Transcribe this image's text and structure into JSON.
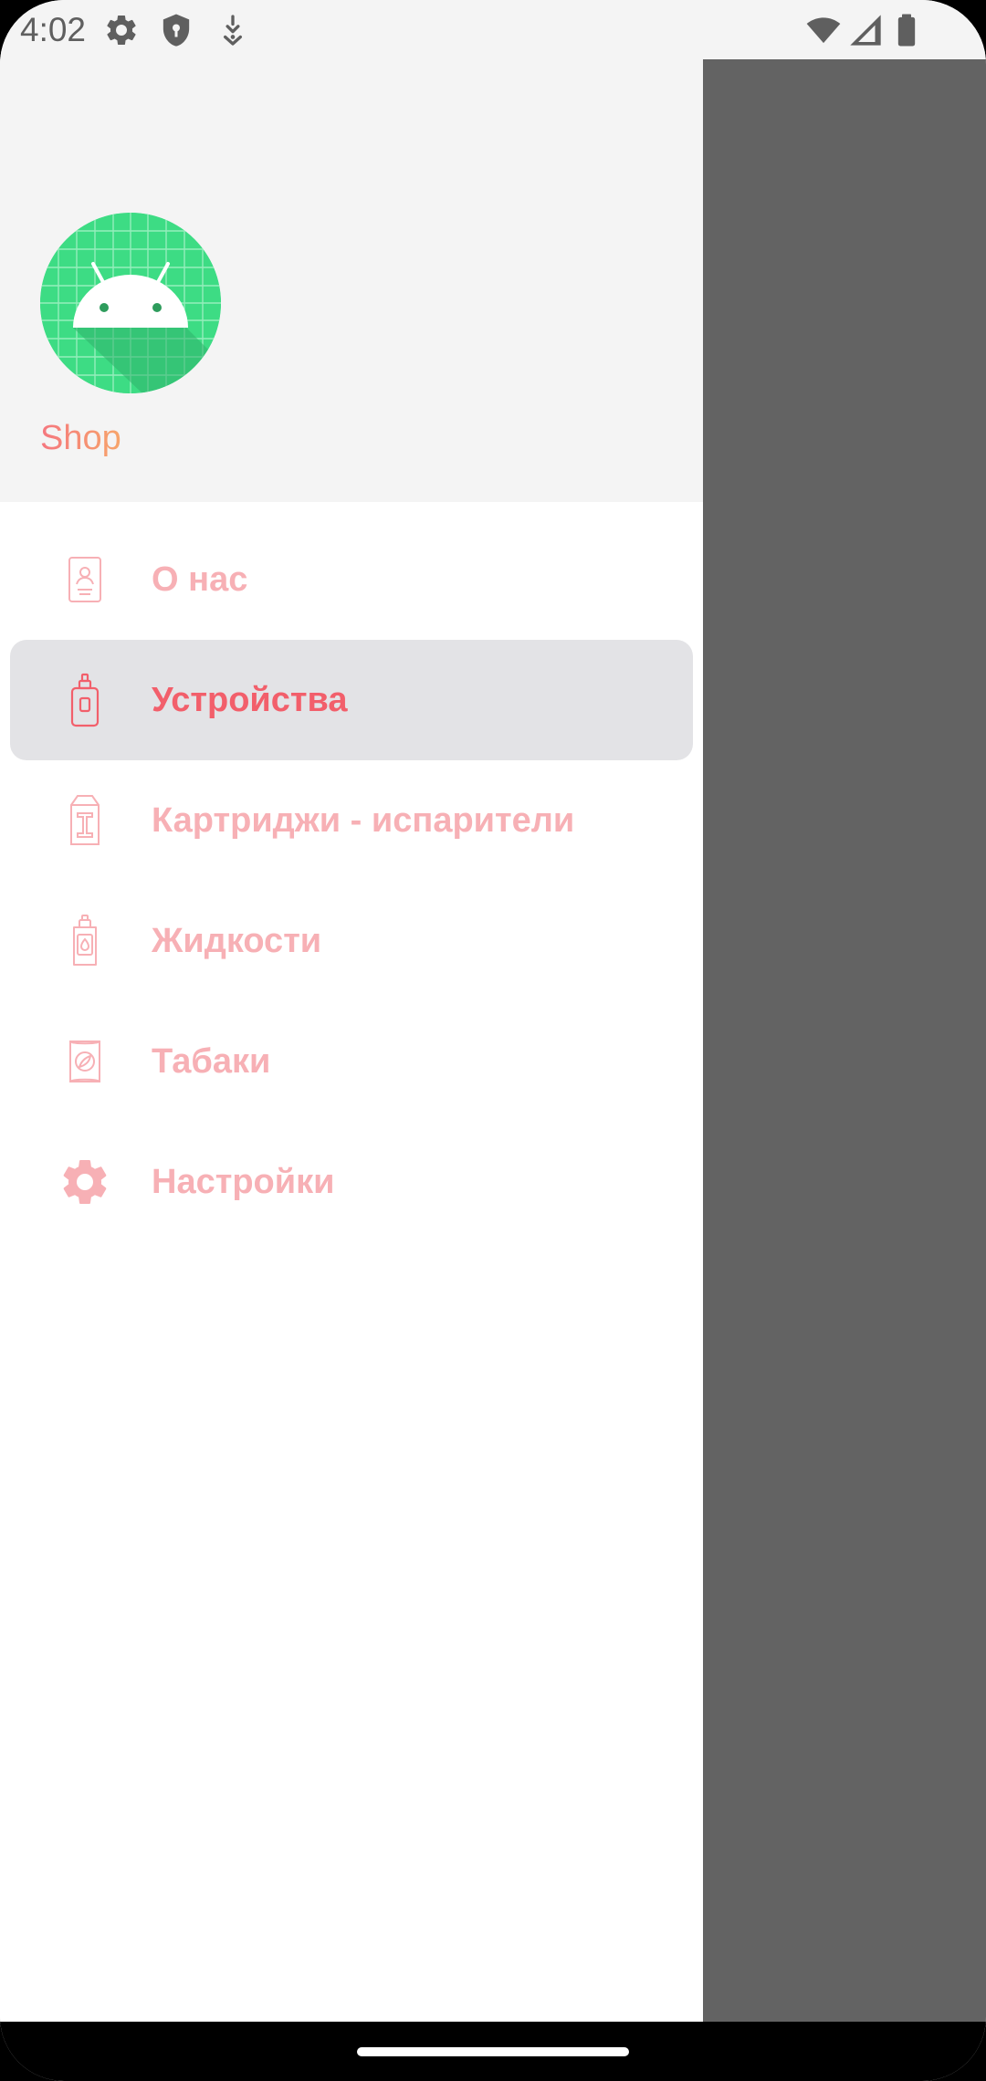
{
  "status_bar": {
    "time": "4:02",
    "left_icons": [
      "gear-icon",
      "shield-icon",
      "download-arrow-icon"
    ],
    "right_icons": [
      "wifi-icon",
      "signal-icon",
      "battery-icon"
    ]
  },
  "drawer": {
    "header": {
      "avatar_icon": "android-icon",
      "title": "Shop",
      "title_gradient": [
        "#f5777f",
        "#f7a56a"
      ]
    },
    "selected_index": 1,
    "items": [
      {
        "label": "О нас",
        "icon": "person-card-icon"
      },
      {
        "label": "Устройства",
        "icon": "vape-device-icon"
      },
      {
        "label": "Картриджи - испарители",
        "icon": "cartridge-icon"
      },
      {
        "label": "Жидкости",
        "icon": "liquid-bottle-icon"
      },
      {
        "label": "Табаки",
        "icon": "tobacco-pack-icon"
      },
      {
        "label": "Настройки",
        "icon": "settings-gear-icon"
      }
    ]
  },
  "colors": {
    "accent": "#f25f6b",
    "accent_light": "#f7b0b5",
    "selected_background": "#e3e3e6",
    "scrim": "#636363",
    "header_background": "#f4f4f4"
  }
}
